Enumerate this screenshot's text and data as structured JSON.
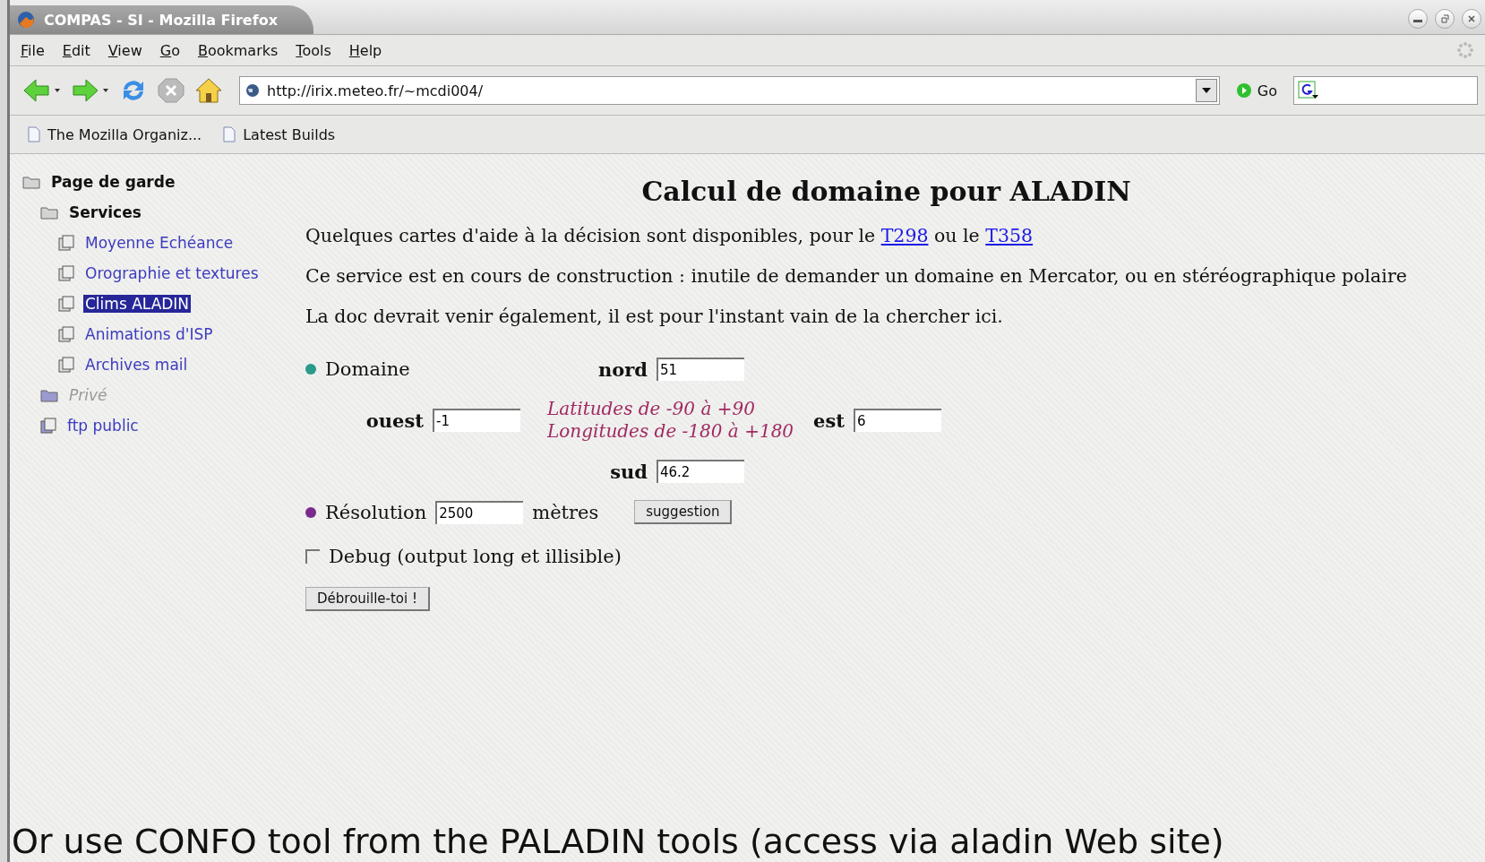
{
  "window": {
    "title": "COMPAS - SI - Mozilla Firefox"
  },
  "menu": [
    {
      "label": "File"
    },
    {
      "label": "Edit"
    },
    {
      "label": "View"
    },
    {
      "label": "Go"
    },
    {
      "label": "Bookmarks"
    },
    {
      "label": "Tools"
    },
    {
      "label": "Help"
    }
  ],
  "toolbar": {
    "url": "http://irix.meteo.fr/~mcdi004/",
    "go": "Go"
  },
  "bookmarks": [
    {
      "label": "The Mozilla Organiz..."
    },
    {
      "label": "Latest Builds"
    }
  ],
  "sidebar": {
    "items": [
      {
        "label": "Page de garde",
        "kind": "folder",
        "selected": false,
        "disabled": false,
        "children": [
          {
            "label": "Services",
            "kind": "folder",
            "selected": false,
            "disabled": false,
            "children": [
              {
                "label": "Moyenne Echéance",
                "kind": "page",
                "selected": false,
                "disabled": false
              },
              {
                "label": "Orographie et textures",
                "kind": "page",
                "selected": false,
                "disabled": false
              },
              {
                "label": "Clims ALADIN",
                "kind": "page",
                "selected": true,
                "disabled": false
              },
              {
                "label": "Animations d'ISP",
                "kind": "page",
                "selected": false,
                "disabled": false
              },
              {
                "label": "Archives mail",
                "kind": "page",
                "selected": false,
                "disabled": false
              }
            ]
          },
          {
            "label": "Privé",
            "kind": "folder",
            "selected": false,
            "disabled": true
          },
          {
            "label": "ftp public",
            "kind": "page",
            "selected": false,
            "disabled": false
          }
        ]
      }
    ]
  },
  "main": {
    "heading": "Calcul de domaine pour ALADIN",
    "paragraphs": [
      [
        {
          "text": "Quelques cartes d'aide à la décision sont disponibles, pour le "
        },
        {
          "link": "T298"
        },
        {
          "text": " ou le "
        },
        {
          "link": "T358"
        }
      ],
      [
        {
          "text": "Ce service est en cours de construction : inutile de demander un domaine en Mercator, ou en stéréographique polaire"
        }
      ],
      [
        {
          "text": "La doc devrait venir également, il est pour l'instant vain de la chercher ici."
        }
      ]
    ],
    "form": {
      "domain_label": "Domaine",
      "nord": {
        "label": "nord",
        "value": "51"
      },
      "ouest": {
        "label": "ouest",
        "value": "-1"
      },
      "est": {
        "label": "est",
        "value": "6"
      },
      "sud": {
        "label": "sud",
        "value": "46.2"
      },
      "hints": [
        "Latitudes de -90 à +90",
        "Longitudes de -180 à +180"
      ],
      "resolution": {
        "label": "Résolution",
        "value": "2500",
        "unit": "mètres",
        "button": "suggestion"
      },
      "debug": {
        "label": "Debug (output long et illisible)",
        "checked": false
      },
      "submit": "Débrouille-toi !"
    }
  },
  "caption": "Or use CONFO tool from the PALADIN tools (access via aladin Web site)"
}
